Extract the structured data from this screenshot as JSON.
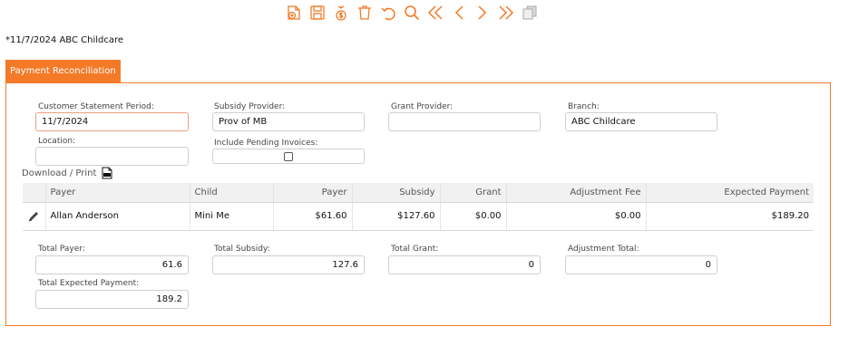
{
  "toolbar": {
    "items": [
      {
        "name": "add-record-icon"
      },
      {
        "name": "save-icon"
      },
      {
        "name": "payment-icon"
      },
      {
        "name": "delete-icon"
      },
      {
        "name": "undo-icon"
      },
      {
        "name": "search-icon"
      },
      {
        "name": "first-record-icon"
      },
      {
        "name": "previous-record-icon"
      },
      {
        "name": "next-record-icon"
      },
      {
        "name": "last-record-icon"
      },
      {
        "name": "copy-icon"
      }
    ],
    "accent": "#f47a28"
  },
  "record_title": "*11/7/2024 ABC Childcare",
  "tab": {
    "label": "Payment Reconciliation"
  },
  "fields": {
    "statement_period": {
      "label": "Customer Statement Period:",
      "value": "11/7/2024"
    },
    "subsidy_provider": {
      "label": "Subsidy Provider:",
      "value": "Prov of MB"
    },
    "grant_provider": {
      "label": "Grant Provider:",
      "value": ""
    },
    "branch": {
      "label": "Branch:",
      "value": "ABC Childcare"
    },
    "location": {
      "label": "Location:",
      "value": ""
    },
    "include_pending": {
      "label": "Include Pending Invoices:",
      "checked": false
    }
  },
  "download": {
    "label": "Download / Print"
  },
  "table": {
    "headers": [
      "Payer",
      "Child",
      "Payer",
      "Subsidy",
      "Grant",
      "Adjustment Fee",
      "Expected Payment"
    ],
    "rows": [
      {
        "payer": "Allan Anderson",
        "child": "Mini Me",
        "payer_amount": "$61.60",
        "subsidy": "$127.60",
        "grant": "$0.00",
        "adjustment_fee": "$0.00",
        "expected_payment": "$189.20"
      }
    ]
  },
  "totals": {
    "payer": {
      "label": "Total Payer:",
      "value": "61.6"
    },
    "subsidy": {
      "label": "Total Subsidy:",
      "value": "127.6"
    },
    "grant": {
      "label": "Total Grant:",
      "value": "0"
    },
    "adjustment": {
      "label": "Adjustment Total:",
      "value": "0"
    },
    "expected": {
      "label": "Total Expected Payment:",
      "value": "189.2"
    }
  }
}
